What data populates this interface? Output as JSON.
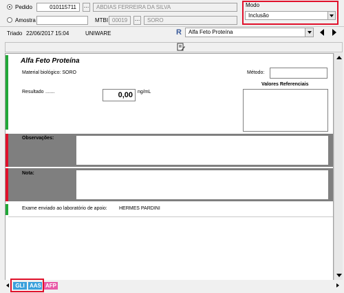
{
  "header": {
    "radio_pedido": "Pedido",
    "pedido_number": "010115711",
    "patient_name": "ABDIAS FERREIRA DA SILVA",
    "radio_amostra": "Amostra",
    "mtbi_label": "MTBI",
    "mtbi_value": "00019",
    "material": "SORO",
    "modo_label": "Modo",
    "modo_value": "Inclusão"
  },
  "infobar": {
    "triado_label": "Triado",
    "triado_datetime": "22/06/2017 15:04",
    "source": "UNIWARE",
    "r_logo": "R",
    "exam_select": "Alfa Feto Proteína"
  },
  "exam": {
    "title": "Alfa Feto Proteína",
    "material_label": "Material biológico: SORO",
    "metodo_label": "Método:",
    "valores_label": "Valores Referenciais",
    "resultado_label": "Resultado",
    "resultado_value": "0,00",
    "unit": "ng/mL",
    "observacoes_label": "Observações:",
    "nota_label": "Nota:",
    "apoio_text": "Exame enviado ao laboratório de apoio:",
    "apoio_lab": "HERMES PARDINI"
  },
  "tabs": [
    {
      "label": "GLI",
      "color": "#3aa0dc"
    },
    {
      "label": "AAS",
      "color": "#3aa0dc"
    },
    {
      "label": "AFP",
      "color": "#e85aa8"
    }
  ],
  "colors": {
    "accent_red": "#e0102a",
    "accent_green": "#21a838",
    "section_gray": "#7f7f7f"
  }
}
